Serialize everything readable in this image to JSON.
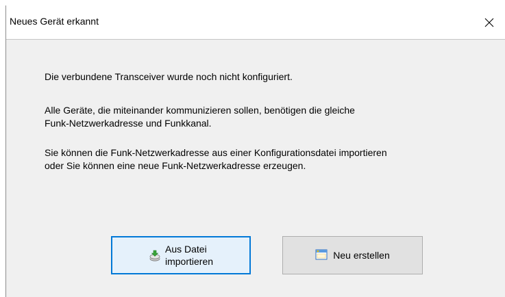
{
  "dialog": {
    "title": "Neues Gerät erkannt",
    "close_icon": "close-icon"
  },
  "message": {
    "line1": "Die verbundene Transceiver wurde noch nicht konfiguriert.",
    "line2": "Alle Geräte, die miteinander kommunizieren sollen, benötigen die gleiche\nFunk-Netzwerkadresse und Funkkanal.",
    "line3": "Sie können die Funk-Netzwerkadresse aus einer Konfigurationsdatei importieren\noder Sie können eine neue Funk-Netzwerkadresse erzeugen."
  },
  "buttons": {
    "import_label": "Aus Datei\nimportieren",
    "import_icon": "import-disk-icon",
    "new_label": "Neu erstellen",
    "new_icon": "new-window-icon"
  },
  "colors": {
    "focus_border": "#0078d7",
    "dialog_bg": "#f0f0f0",
    "button_bg": "#e1e1e1"
  }
}
